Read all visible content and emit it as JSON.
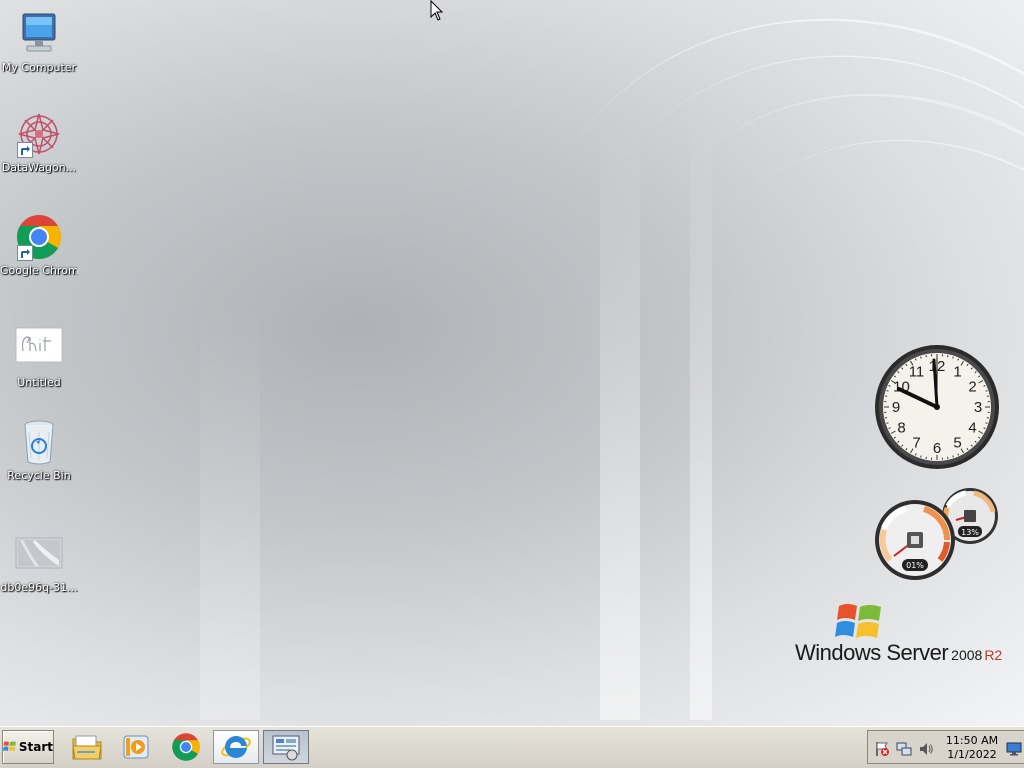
{
  "os": {
    "brand_main": "Windows Server",
    "brand_year": "2008",
    "brand_edition": "R2"
  },
  "desktop_icons": [
    {
      "label": "My Computer",
      "icon": "computer-icon",
      "shortcut": false
    },
    {
      "label": "DataWagon...",
      "icon": "datawagon-icon",
      "shortcut": true
    },
    {
      "label": "Google Chrome",
      "icon": "chrome-icon",
      "shortcut": true
    },
    {
      "label": "Untitled",
      "icon": "image-file-icon",
      "shortcut": false
    },
    {
      "label": "Recycle Bin",
      "icon": "recycle-bin-icon",
      "shortcut": false
    },
    {
      "label": "db0e96q-31...",
      "icon": "image-thumbnail-icon",
      "shortcut": false
    }
  ],
  "gadgets": {
    "clock": {
      "numerals": [
        "12",
        "1",
        "2",
        "3",
        "4",
        "5",
        "6",
        "7",
        "8",
        "9",
        "10",
        "11"
      ]
    },
    "cpu_meter": {
      "cpu_label": "01%",
      "memory_label": "13%"
    }
  },
  "taskbar": {
    "start_label": "Start",
    "buttons": [
      {
        "icon": "file-explorer-icon"
      },
      {
        "icon": "media-player-icon"
      },
      {
        "icon": "chrome-icon"
      },
      {
        "icon": "internet-explorer-icon",
        "state": "active"
      },
      {
        "icon": "server-manager-icon",
        "state": "pressed"
      }
    ]
  },
  "tray": {
    "time": "11:50 AM",
    "date": "1/1/2022",
    "icons": [
      "action-center-flag-icon",
      "network-icon",
      "volume-icon"
    ]
  },
  "colors": {
    "taskbar_bg": "#d4d0c8",
    "desktop_center": "#aeb2b6",
    "desktop_edge": "#f3f4f5",
    "brand_r2": "#c0392b"
  }
}
